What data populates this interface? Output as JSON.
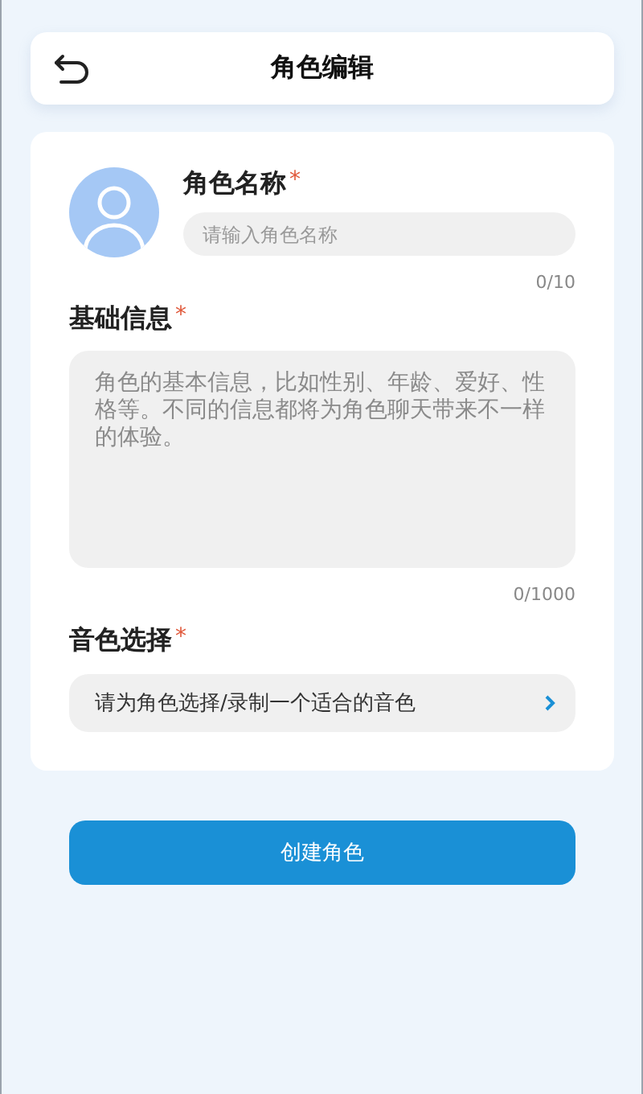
{
  "header": {
    "title": "角色编辑"
  },
  "name_field": {
    "label": "角色名称",
    "required_mark": "*",
    "placeholder": "请输入角色名称",
    "counter": "0/10"
  },
  "info_field": {
    "label": "基础信息",
    "required_mark": "*",
    "placeholder": "角色的基本信息，比如性别、年龄、爱好、性格等。不同的信息都将为角色聊天带来不一样的体验。",
    "counter": "0/1000"
  },
  "voice_field": {
    "label": "音色选择",
    "required_mark": "*",
    "value": "请为角色选择/录制一个适合的音色"
  },
  "submit_button": "创建角色"
}
